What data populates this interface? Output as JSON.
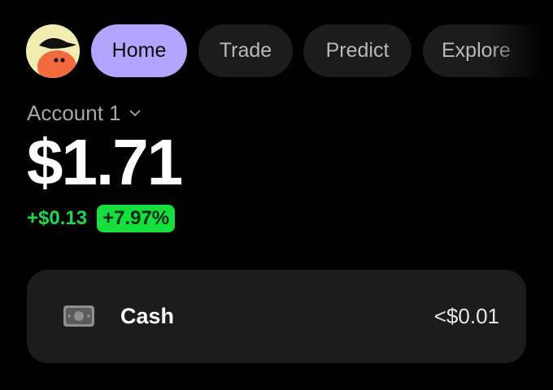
{
  "nav": {
    "avatar_icon": "hat-mascot-avatar",
    "tabs": [
      {
        "label": "Home",
        "active": true
      },
      {
        "label": "Trade",
        "active": false
      },
      {
        "label": "Predict",
        "active": false
      },
      {
        "label": "Explore",
        "active": false
      }
    ]
  },
  "account": {
    "name": "Account 1",
    "selector_icon": "chevron-down-icon",
    "balance": "$1.71",
    "change_amount": "+$0.13",
    "change_percent": "+7.97%"
  },
  "holdings": [
    {
      "icon": "cash-icon",
      "label": "Cash",
      "value": "<$0.01"
    }
  ],
  "colors": {
    "background": "#000000",
    "active_tab": "#b3a5ff",
    "inactive_tab": "#1c1c1e",
    "positive": "#1dd84a",
    "positive_badge": "#14df3d",
    "card": "#1c1c1e"
  }
}
